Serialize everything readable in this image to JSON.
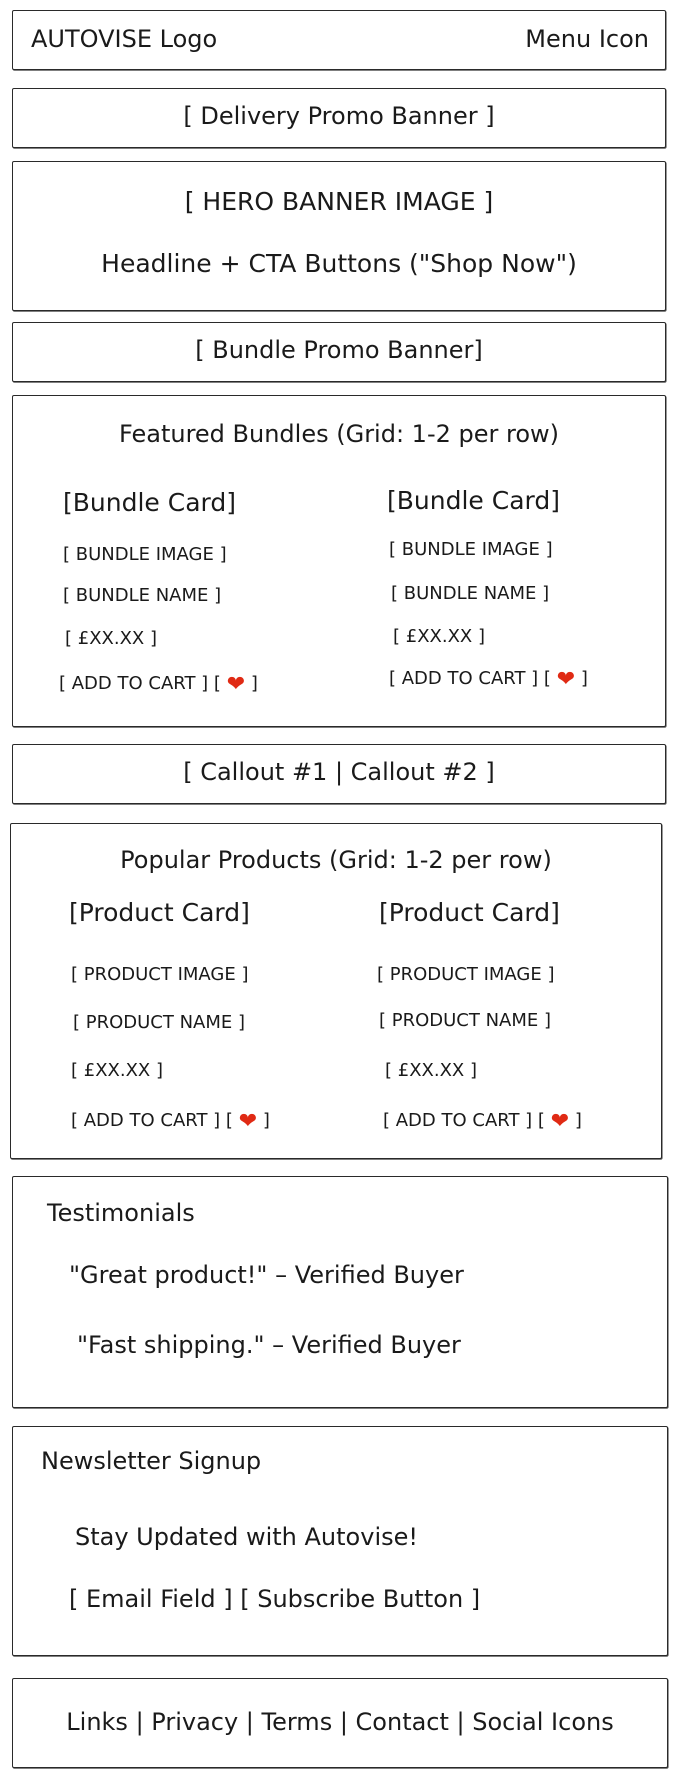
{
  "header": {
    "logo": "AUTOVISE Logo",
    "menu": "Menu Icon"
  },
  "delivery_banner": "[ Delivery Promo Banner ]",
  "hero": {
    "image": "[ HERO BANNER IMAGE ]",
    "text": "Headline + CTA Buttons (\"Shop Now\")"
  },
  "bundle_banner": "[ Bundle Promo Banner]",
  "featured": {
    "title": "Featured Bundles (Grid: 1-2 per row)",
    "cards": [
      {
        "title": "[Bundle Card]",
        "image": "[ BUNDLE IMAGE ]",
        "name": "[ BUNDLE NAME ]",
        "price": "[ £XX.XX ]",
        "cart_prefix": "[ ADD TO CART ] [",
        "cart_suffix": "]"
      },
      {
        "title": "[Bundle Card]",
        "image": "[ BUNDLE IMAGE ]",
        "name": "[ BUNDLE NAME ]",
        "price": "[ £XX.XX ]",
        "cart_prefix": "[ ADD TO CART ] [",
        "cart_suffix": "]"
      }
    ]
  },
  "callouts": "[ Callout #1 | Callout #2 ]",
  "popular": {
    "title": "Popular Products (Grid: 1-2 per row)",
    "cards": [
      {
        "title": "[Product Card]",
        "image": "[ PRODUCT IMAGE ]",
        "name": "[ PRODUCT NAME ]",
        "price": "[ £XX.XX ]",
        "cart_prefix": "[ ADD TO CART ] [",
        "cart_suffix": "]"
      },
      {
        "title": "[Product Card]",
        "image": "[ PRODUCT IMAGE ]",
        "name": "[ PRODUCT NAME ]",
        "price": "[ £XX.XX ]",
        "cart_prefix": "[ ADD TO CART ] [",
        "cart_suffix": "]"
      }
    ]
  },
  "testimonials": {
    "title": "Testimonials",
    "items": [
      "\"Great product!\" – Verified Buyer",
      "\"Fast shipping.\" – Verified Buyer"
    ]
  },
  "newsletter": {
    "title": "Newsletter Signup",
    "tagline": "Stay Updated with Autovise!",
    "form": "[ Email Field ] [ Subscribe Button ]"
  },
  "footer": "Links | Privacy | Terms | Contact | Social Icons",
  "colors": {
    "heart": "#e02a14",
    "border": "#2a2a2a"
  },
  "icons": {
    "heart": "heart-icon"
  }
}
